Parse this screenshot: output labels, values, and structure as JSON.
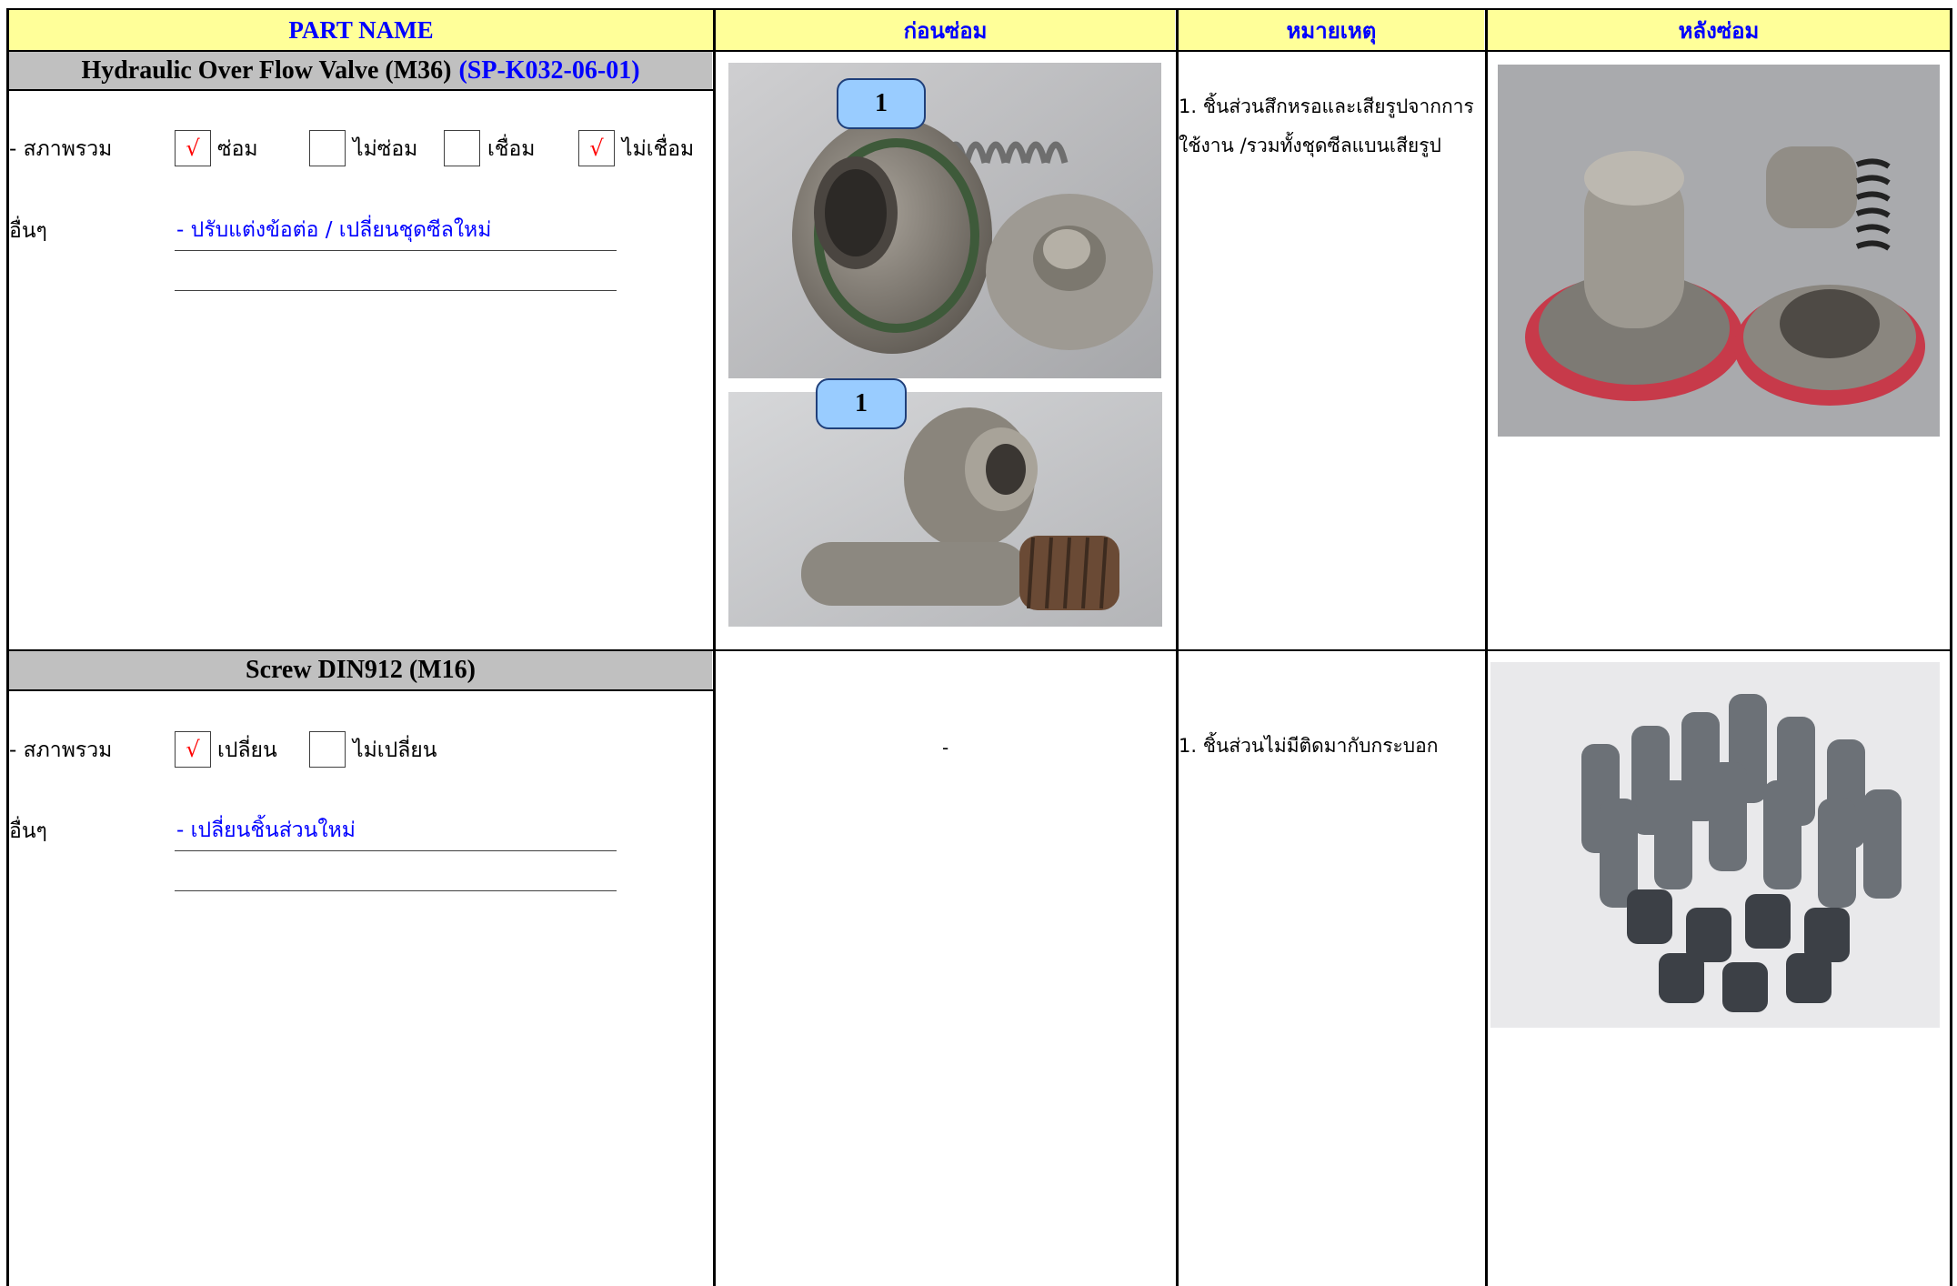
{
  "headers": {
    "part_name": "PART NAME",
    "before": "ก่อนซ่อม",
    "remark": "หมายเหตุ",
    "after": "หลังซ่อม"
  },
  "part1": {
    "name": "Hydraulic Over Flow Valve (M36)",
    "code": "(SP-K032-06-01)",
    "condition_label": "- สภาพรวม",
    "options": [
      {
        "label": "ซ่อม",
        "mark": "√"
      },
      {
        "label": "ไม่ซ่อม",
        "mark": ""
      },
      {
        "label": "เชื่อม",
        "mark": ""
      },
      {
        "label": "ไม่เชื่อม",
        "mark": "√"
      }
    ],
    "other_label": "อื่นๆ",
    "other_text": "- ปรับแต่งข้อต่อ / เปลี่ยนชุดซีลใหม่",
    "remark_lines": [
      "1. ชิ้นส่วนสึกหรอและเสียรูปจากการ",
      "ใช้งาน /รวมทั้งชุดซีลแบนเสียรูป"
    ],
    "callout_1": "1",
    "callout_2": "1"
  },
  "part2": {
    "name": "Screw DIN912  (M16)",
    "condition_label": "- สภาพรวม",
    "options": [
      {
        "label": "เปลี่ยน",
        "mark": "√"
      },
      {
        "label": "ไม่เปลี่ยน",
        "mark": ""
      }
    ],
    "other_label": "อื่นๆ",
    "other_text": "- เปลี่ยนชิ้นส่วนใหม่",
    "before_text": "-",
    "remark_lines": [
      "1. ชิ้นส่วนไม่มีติดมากับกระบอก"
    ]
  }
}
